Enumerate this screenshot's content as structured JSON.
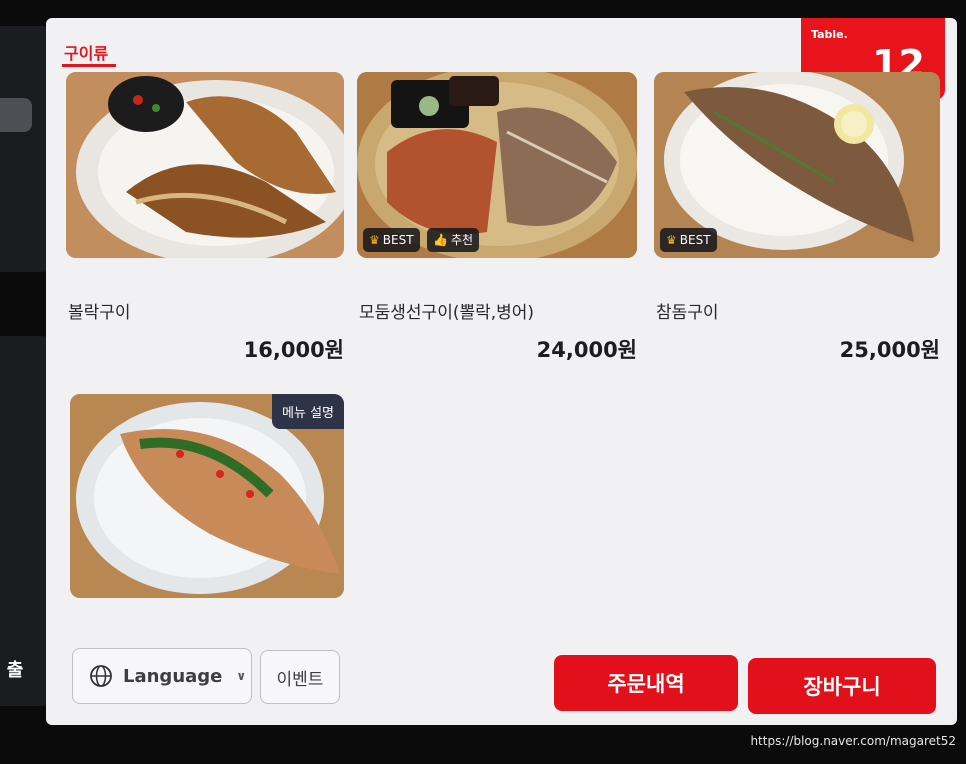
{
  "side": {
    "exit_label": "출"
  },
  "category": {
    "active_tab": "구이류"
  },
  "table": {
    "label": "Table.",
    "number": "12"
  },
  "menu": {
    "items": [
      {
        "name": "볼락구이",
        "price": "16,000원"
      },
      {
        "name": "모둠생선구이(뽈락,병어)",
        "price": "24,000원",
        "tag_best": "BEST",
        "tag_recommend": "추천"
      },
      {
        "name": "참돔구이",
        "price": "25,000원",
        "tag_best": "BEST"
      },
      {
        "description_tag": "메뉴 설명"
      }
    ]
  },
  "footer": {
    "language_label": "Language",
    "event_label": "이벤트",
    "order_history_label": "주문내역",
    "cart_label": "장바구니"
  },
  "watermark": "https://blog.naver.com/magaret52",
  "colors": {
    "accent": "#e2101a",
    "background": "#f1f1f3",
    "tag_bg": "#18181c",
    "desc_tag_bg": "#2e3347"
  },
  "icons": {
    "language": "globe-icon",
    "dropdown": "chevron-down-icon",
    "best": "crown-icon",
    "recommend": "thumbs-up-icon"
  }
}
